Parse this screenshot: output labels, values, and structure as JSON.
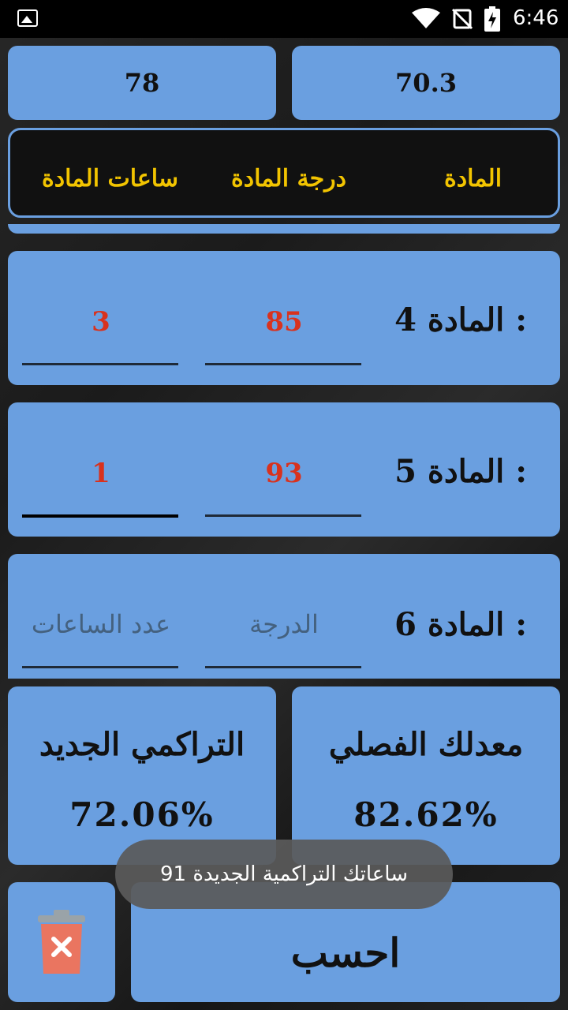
{
  "status_bar": {
    "time": "6:46"
  },
  "totals": {
    "left_value": "78",
    "right_value": "70.3"
  },
  "header": {
    "col_hours": "ساعات المادة",
    "col_grade": "درجة المادة",
    "col_subject": "المادة"
  },
  "rows": [
    {
      "label": "المادة 4  :",
      "grade": "85",
      "hours": "3"
    },
    {
      "label": "المادة 5  :",
      "grade": "93",
      "hours": "1"
    },
    {
      "label": "المادة 6  :",
      "grade_placeholder": "الدرجة",
      "hours_placeholder": "عدد الساعات"
    }
  ],
  "results": {
    "cumulative_title": "التراكمي الجديد",
    "cumulative_value": "72.06%",
    "semester_title": "معدلك الفصلي",
    "semester_value": "82.62%"
  },
  "actions": {
    "calculate_label": "احسب"
  },
  "toast": {
    "message": "ساعاتك التراكمية الجديدة 91"
  },
  "colors": {
    "card": "#6a9fe0",
    "accent_text": "#f2c400",
    "value_red": "#d8321e"
  }
}
